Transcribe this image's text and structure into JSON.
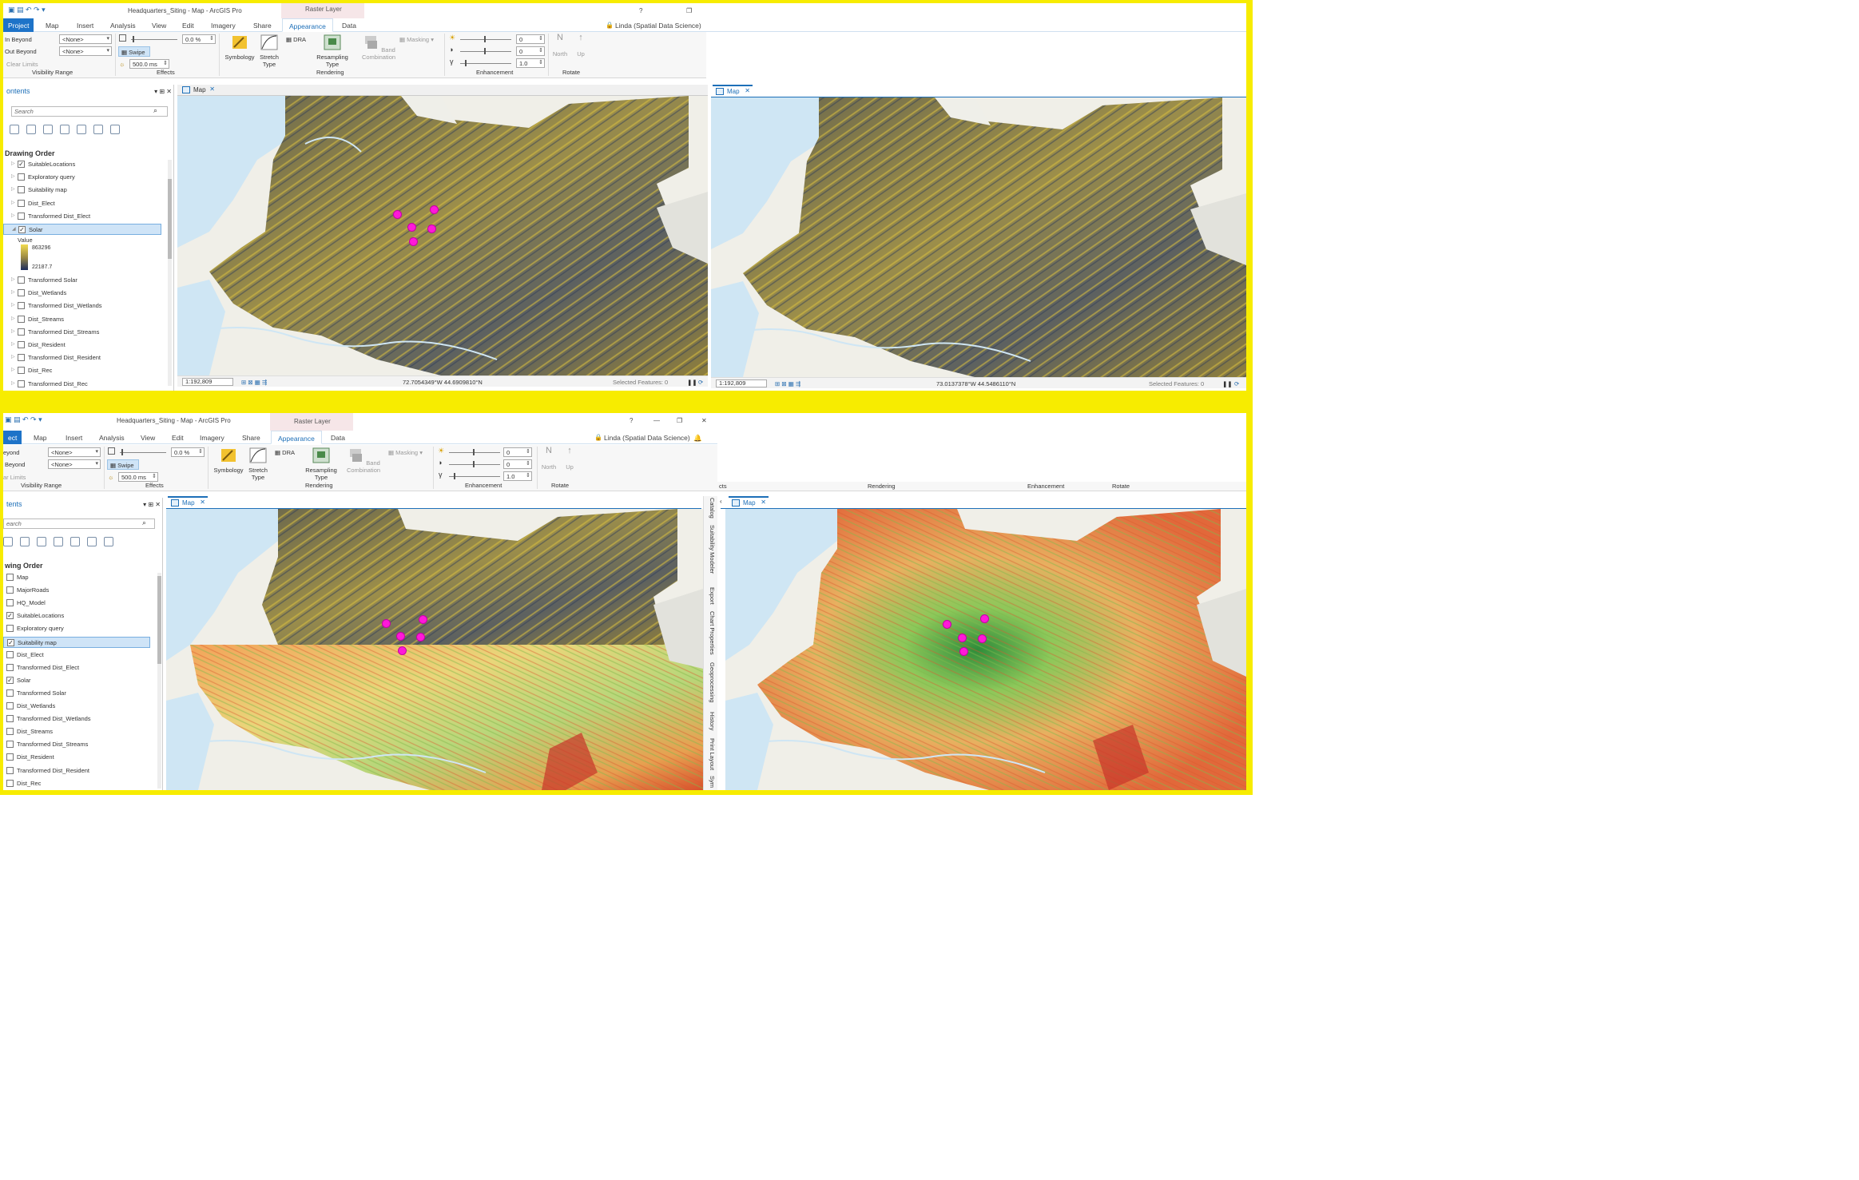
{
  "top": {
    "title": "Headquarters_Siting - Map - ArcGIS Pro",
    "context_tab": "Raster Layer",
    "help": "?",
    "tabs": [
      "Project",
      "Map",
      "Insert",
      "Analysis",
      "View",
      "Edit",
      "Imagery",
      "Share",
      "Appearance",
      "Data"
    ],
    "user": "Linda (Spatial Data Science)",
    "visibility": {
      "in_beyond": "In Beyond",
      "out_beyond": "Out Beyond",
      "none1": "<None>",
      "none2": "<None>",
      "clear": "Clear Limits",
      "group": "Visibility Range"
    },
    "effects": {
      "transparency": "0.0 %",
      "swipe": "Swipe",
      "ms": "500.0 ms",
      "group": "Effects"
    },
    "rendering": {
      "symbology": "Symbology",
      "stretch": "Stretch Type",
      "dra": "DRA",
      "resampling": "Resampling Type",
      "band": "Band Combination",
      "masking": "Masking",
      "group": "Rendering"
    },
    "enhancement": {
      "v1": "0",
      "v2": "0",
      "v3": "1.0",
      "group": "Enhancement"
    },
    "rotate": {
      "north": "North",
      "up": "Up",
      "group": "Rotate"
    },
    "contents": {
      "title": "ontents",
      "search": "Search",
      "drawing_order": "Drawing Order",
      "layers": [
        "SuitableLocations",
        "Exploratory query",
        "Suitability map",
        "Dist_Elect",
        "Transformed Dist_Elect",
        "Solar"
      ],
      "layers2": [
        "Transformed Solar",
        "Dist_Wetlands",
        "Transformed Dist_Wetlands",
        "Dist_Streams",
        "Transformed Dist_Streams",
        "Dist_Resident",
        "Transformed Dist_Resident",
        "Dist_Rec",
        "Transformed Dist_Rec"
      ],
      "legend_value": "Value",
      "legend_high": "863296",
      "legend_low": "22187.7"
    },
    "map_tab": "Map",
    "scale": "1:192,809",
    "coords_left": "72.7054349°W 44.6909810°N",
    "coords_right": "73.0137378°W 44.5486110°N",
    "selected": "Selected Features: 0"
  },
  "bottom": {
    "title": "Headquarters_Siting - Map - ArcGIS Pro",
    "context_tab": "Raster Layer",
    "help": "?",
    "tabs": [
      "ect",
      "Map",
      "Insert",
      "Analysis",
      "View",
      "Edit",
      "Imagery",
      "Share",
      "Appearance",
      "Data"
    ],
    "user": "Linda (Spatial Data Science)",
    "visibility": {
      "in_beyond": "eyond",
      "out_beyond": "Beyond",
      "none1": "<None>",
      "none2": "<None>",
      "clear": "ar Limits",
      "group": "Visibility Range"
    },
    "effects": {
      "transparency": "0.0 %",
      "swipe": "Swipe",
      "ms": "500.0 ms",
      "group": "Effects"
    },
    "rendering": {
      "symbology": "Symbology",
      "stretch": "Stretch Type",
      "dra": "DRA",
      "resampling": "Resampling Type",
      "band": "Band Combination",
      "masking": "Masking",
      "group": "Rendering"
    },
    "enhancement": {
      "v1": "0",
      "v2": "0",
      "v3": "1.0",
      "group": "Enhancement"
    },
    "rotate": {
      "north": "North",
      "up": "Up",
      "group": "Rotate"
    },
    "right_ribbon": {
      "cts": "cts",
      "rendering": "Rendering",
      "enhancement": "Enhancement",
      "rotate": "Rotate"
    },
    "contents": {
      "title": "tents",
      "search": "earch",
      "drawing_order": "wing Order",
      "layers": [
        "Map",
        "MajorRoads",
        "HQ_Model",
        "SuitableLocations",
        "Exploratory query",
        "Suitability map",
        "Dist_Elect",
        "Transformed Dist_Elect",
        "Solar",
        "Transformed Solar",
        "Dist_Wetlands",
        "Transformed Dist_Wetlands",
        "Dist_Streams",
        "Transformed Dist_Streams",
        "Dist_Resident",
        "Transformed Dist_Resident",
        "Dist_Rec"
      ]
    },
    "map_tab": "Map",
    "side_panels": [
      "Catalog",
      "Suitability Modeler",
      "Export",
      "Chart Properties",
      "Geoprocessing",
      "History",
      "Print Layout",
      "Sym"
    ]
  },
  "colors": {
    "accent": "#1e73c8",
    "highlight": "#f7ec00",
    "pin": "#ff19d9"
  }
}
